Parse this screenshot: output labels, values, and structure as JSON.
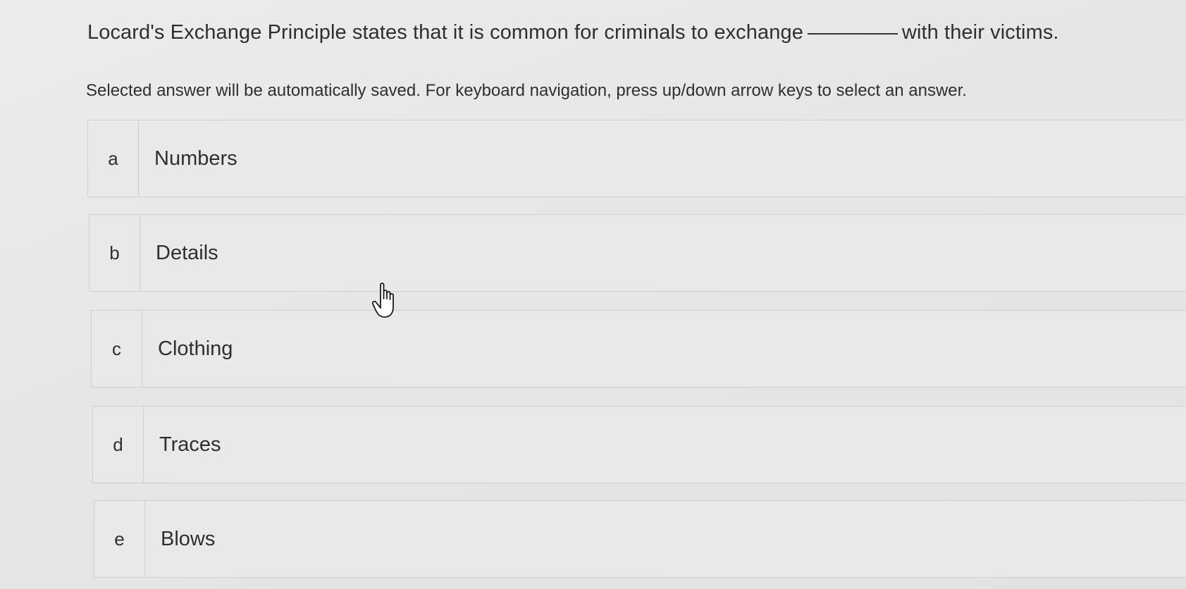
{
  "question": {
    "before_blank": "Locard's Exchange Principle states that it is common for criminals to exchange",
    "after_blank": "with their victims."
  },
  "instructions": "Selected answer will be automatically saved. For keyboard navigation, press up/down arrow keys to select an answer.",
  "options": [
    {
      "letter": "a",
      "text": "Numbers"
    },
    {
      "letter": "b",
      "text": "Details"
    },
    {
      "letter": "c",
      "text": "Clothing"
    },
    {
      "letter": "d",
      "text": "Traces"
    },
    {
      "letter": "e",
      "text": "Blows"
    }
  ],
  "cursor_icon": "hand-pointer-icon"
}
